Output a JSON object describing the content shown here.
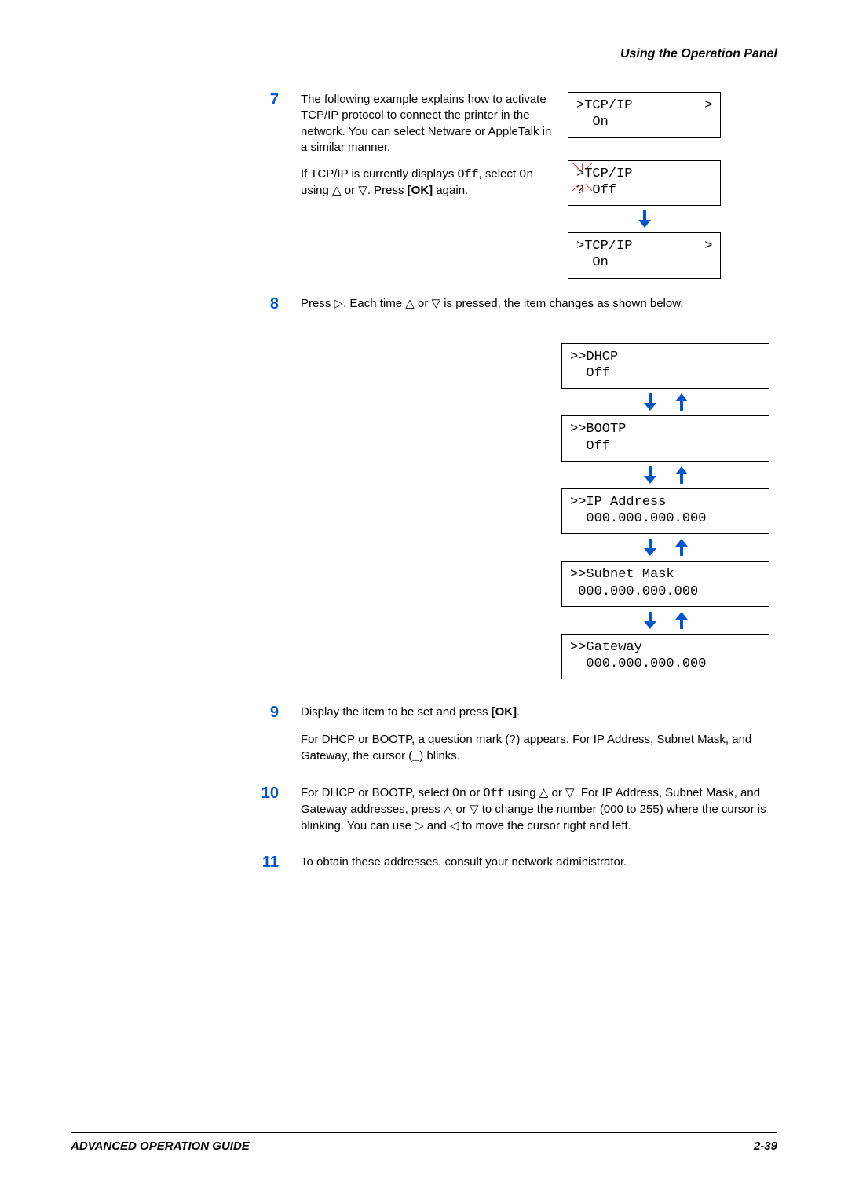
{
  "header": {
    "section_title": "Using the Operation Panel"
  },
  "steps": {
    "s7": {
      "num": "7",
      "p1": "The following example explains how to activate TCP/IP protocol to connect the printer in the network. You can select Netware or AppleTalk in a similar manner.",
      "p2_a": "If TCP/IP is currently displays ",
      "p2_off": "Off",
      "p2_b": ", select ",
      "p2_on": "On",
      "p2_c": " using ",
      "p2_d": " or ",
      "p2_e": ". Press ",
      "p2_ok": "[OK]",
      "p2_f": " again.",
      "lcd_a": ">TCP/IP         >\n  On",
      "lcd_b": ">TCP/IP\n? Off",
      "lcd_c": ">TCP/IP         >\n  On"
    },
    "s8": {
      "num": "8",
      "p_a": "Press ",
      "p_b": ". Each time ",
      "p_c": " or ",
      "p_d": " is pressed, the item changes as shown below.",
      "lcd1": ">>DHCP\n  Off",
      "lcd2": ">>BOOTP\n  Off",
      "lcd3": ">>IP Address\n  000.000.000.000",
      "lcd4": ">>Subnet Mask\n 000.000.000.000",
      "lcd5": ">>Gateway\n  000.000.000.000"
    },
    "s9": {
      "num": "9",
      "p1_a": "Display the item to be set and press ",
      "p1_ok": "[OK]",
      "p1_b": ".",
      "p2_a": "For DHCP or BOOTP, a question mark (",
      "p2_q": "?",
      "p2_b": ") appears. For IP Address, Subnet Mask, and Gateway, the cursor (",
      "p2_u": "_",
      "p2_c": ") blinks."
    },
    "s10": {
      "num": "10",
      "p_a": "For DHCP or BOOTP, select ",
      "p_on": "On",
      "p_b": " or ",
      "p_off": "Off",
      "p_c": " using ",
      "p_d": " or ",
      "p_e": ". For IP Address, Subnet Mask, and Gateway addresses, press ",
      "p_f": " or ",
      "p_g": " to change the number (000 to 255) where the cursor is blinking. You can use ",
      "p_h": " and ",
      "p_i": " to move the cursor right and left."
    },
    "s11": {
      "num": "11",
      "p": "To obtain these addresses, consult your network administrator."
    }
  },
  "footer": {
    "left": "ADVANCED OPERATION GUIDE",
    "right": "2-39"
  },
  "icons": {
    "down_arrow_color": "#0055cc",
    "up_arrow_color": "#0055cc"
  }
}
